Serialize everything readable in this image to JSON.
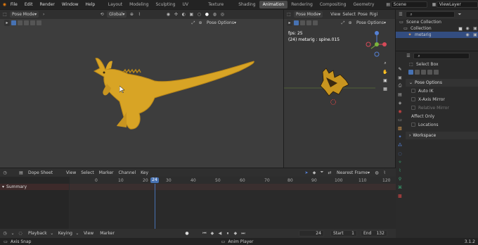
{
  "topbar": {
    "menus": [
      "File",
      "Edit",
      "Render",
      "Window",
      "Help"
    ],
    "workspaces": [
      "Layout",
      "Modeling",
      "Sculpting",
      "UV Editing",
      "Texture Paint",
      "Shading",
      "Animation",
      "Rendering",
      "Compositing",
      "Geometry Nod"
    ],
    "active_workspace": "Animation",
    "scene": "Scene",
    "view_layer": "ViewLayer"
  },
  "viewport_left": {
    "mode": "Pose Mode",
    "orientation": "Global",
    "pose_options": "Pose Options"
  },
  "viewport_right": {
    "mode": "Pose Mode",
    "menus": [
      "View",
      "Select",
      "Pose",
      "Rigi"
    ],
    "pose_options": "Pose Options",
    "fps": "fps: 25",
    "info": "(24) metarig : spine.015"
  },
  "outliner": {
    "items": [
      "Scene Collection",
      "Collection",
      "metarig"
    ]
  },
  "properties": {
    "select_box": "Select Box",
    "pose_options_title": "Pose Options",
    "auto_ik": "Auto IK",
    "x_axis_mirror": "X-Axis Mirror",
    "relative_mirror": "Relative Mirror",
    "affect_only": "Affect Only",
    "locations": "Locations",
    "workspace": "Workspace"
  },
  "dopesheet": {
    "mode": "Dope Sheet",
    "menus": [
      "View",
      "Select",
      "Marker",
      "Channel",
      "Key"
    ],
    "interpolation": "Nearest Frame",
    "summary": "Summary",
    "current_frame": "24",
    "ticks": [
      "0",
      "10",
      "20",
      "30",
      "40",
      "50",
      "60",
      "70",
      "80",
      "90",
      "100",
      "110",
      "120"
    ]
  },
  "playback": {
    "menus": [
      "Playback",
      "Keying",
      "View",
      "Marker"
    ],
    "frame": "24",
    "start_label": "Start",
    "start": "1",
    "end_label": "End",
    "end": "132"
  },
  "status": {
    "left": "Axis Snap",
    "mid": "Anim Player",
    "version": "3.1.2"
  }
}
